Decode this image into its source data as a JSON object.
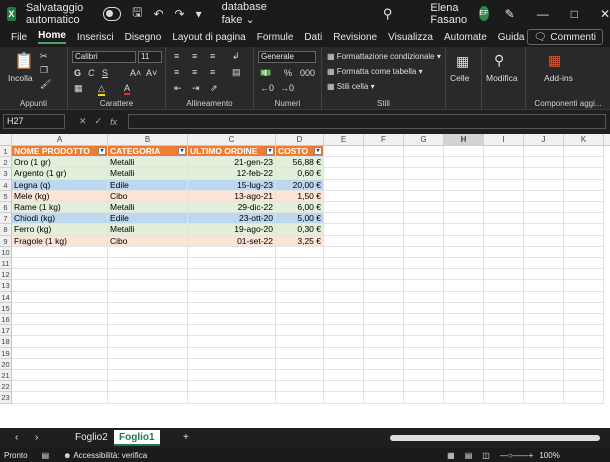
{
  "title_bar": {
    "app_icon": "X",
    "autosave_label": "Salvataggio automatico",
    "file_name": "database fake",
    "user_name": "Elena Fasano",
    "user_initials": "EF"
  },
  "menu": {
    "tabs": [
      "File",
      "Home",
      "Inserisci",
      "Disegno",
      "Layout di pagina",
      "Formule",
      "Dati",
      "Revisione",
      "Visualizza",
      "Automate",
      "Guida"
    ],
    "active_tab": "Home",
    "comments_label": "Commenti"
  },
  "ribbon": {
    "paste_label": "Incolla",
    "clipboard_label": "Appunti",
    "font_name": "Calibri",
    "font_size": "11",
    "font_group_label": "Carattere",
    "bold": "G",
    "italic": "C",
    "underline": "S",
    "font_grow": "A˄",
    "font_shrink": "A˅",
    "align_group_label": "Allineamento",
    "number_format": "Generale",
    "number_group_label": "Numeri",
    "cond_format_label": "Formattazione condizionale",
    "table_format_label": "Formatta come tabella",
    "cell_styles_label": "Stili cella",
    "styles_group_label": "Stili",
    "cells_label": "Celle",
    "edit_label": "Modifica",
    "addins_label": "Add-ins",
    "addins_group_label": "Componenti aggi..."
  },
  "formula_bar": {
    "name_box": "H27",
    "fx": "fx",
    "formula": ""
  },
  "sheet": {
    "columns": [
      "A",
      "B",
      "C",
      "D",
      "E",
      "F",
      "G",
      "H",
      "I",
      "J",
      "K"
    ],
    "selected_column": "H",
    "row_count": 23,
    "headers": [
      "NOME PRODOTTO",
      "CATEGORIA",
      "ULTIMO ORDINE",
      "COSTO"
    ],
    "rows": [
      {
        "name": "Oro (1 gr)",
        "category": "Metalli",
        "date": "21-gen-23",
        "cost": "56,88 €",
        "color": "#e2efda"
      },
      {
        "name": "Argento (1 gr)",
        "category": "Metalli",
        "date": "12-feb-22",
        "cost": "0,60 €",
        "color": "#e2efda"
      },
      {
        "name": "Legna (q)",
        "category": "Edile",
        "date": "15-lug-23",
        "cost": "20,00 €",
        "color": "#bdd7ee"
      },
      {
        "name": "Mele (kg)",
        "category": "Cibo",
        "date": "13-ago-21",
        "cost": "1,50 €",
        "color": "#fce4d6"
      },
      {
        "name": "Rame (1 kg)",
        "category": "Metalli",
        "date": "29-dic-22",
        "cost": "6,00 €",
        "color": "#e2efda"
      },
      {
        "name": "Chiodi (kg)",
        "category": "Edile",
        "date": "23-ott-20",
        "cost": "5,00 €",
        "color": "#bdd7ee"
      },
      {
        "name": "Ferro (kg)",
        "category": "Metalli",
        "date": "19-ago-20",
        "cost": "0,30 €",
        "color": "#e2efda"
      },
      {
        "name": "Fragole (1 kg)",
        "category": "Cibo",
        "date": "01-set-22",
        "cost": "3,25 €",
        "color": "#fce4d6"
      }
    ]
  },
  "sheet_tabs": {
    "tabs": [
      "Foglio2",
      "Foglio1"
    ],
    "active": "Foglio1",
    "add_label": "+"
  },
  "status_bar": {
    "ready": "Pronto",
    "accessibility": "Accessibilità: verifica",
    "zoom": "100%"
  }
}
